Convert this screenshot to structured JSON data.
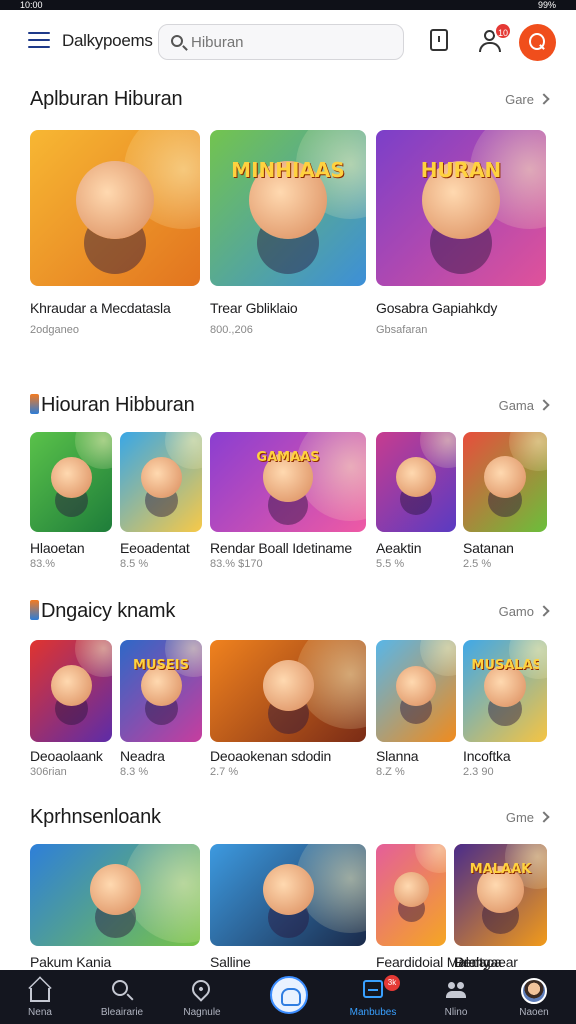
{
  "statusbar": {
    "left": "10:00",
    "right": "99%"
  },
  "header": {
    "brand": "Dalkypoems",
    "search": {
      "value": "",
      "placeholder": "Hiburan"
    },
    "notification_count": "10"
  },
  "sections": [
    {
      "title": "Aplburan Hiburan",
      "more": "Gare",
      "marker": false,
      "items": [
        {
          "title": "Khraudar a Mecdatasla",
          "meta": "2odganeo",
          "colors": [
            "#f7b733",
            "#e2741f"
          ],
          "banner": ""
        },
        {
          "title": "Trear Gbliklaio",
          "meta": "800.,206",
          "colors": [
            "#73c44e",
            "#3d8fd8"
          ],
          "banner": "MINHIAAS"
        },
        {
          "title": "Gosabra Gapiahkdy",
          "meta": "Gbsafaran",
          "colors": [
            "#7b3fc9",
            "#e0529a"
          ],
          "banner": "HURAN"
        }
      ]
    },
    {
      "title": "Hiouran Hibburan",
      "more": "Gama",
      "marker": true,
      "items": [
        {
          "title": "Hlaoetan",
          "meta": "83.%",
          "colors": [
            "#5ac24a",
            "#1e7d3a"
          ],
          "banner": ""
        },
        {
          "title": "Eeoadentat",
          "meta": "8.5 %",
          "colors": [
            "#39a7e6",
            "#f7c948"
          ],
          "banner": ""
        },
        {
          "title": "Rendar Boall Idetiname",
          "meta": "83.% $170",
          "colors": [
            "#8a3ed1",
            "#ef5aa4"
          ],
          "banner": "GAMAAS"
        },
        {
          "title": "Aeaktin",
          "meta": "5.5 %",
          "colors": [
            "#c73c8f",
            "#5a3bc2"
          ],
          "banner": ""
        },
        {
          "title": "Satanan",
          "meta": "2.5 %",
          "colors": [
            "#e84d3c",
            "#6bbf3b"
          ],
          "banner": ""
        }
      ]
    },
    {
      "title": "Dngaicy knamk",
      "more": "Gamo",
      "marker": true,
      "items": [
        {
          "title": "Deoaolaank",
          "meta": "306rian",
          "colors": [
            "#e0342f",
            "#5d2ca8"
          ],
          "banner": ""
        },
        {
          "title": "Neadra",
          "meta": "8.3 %",
          "colors": [
            "#2e68c7",
            "#c73d9e"
          ],
          "banner": "MUSEIS"
        },
        {
          "title": "Deoaokenan sdodin",
          "meta": "2.7 %",
          "colors": [
            "#f0821e",
            "#7a2b16"
          ],
          "banner": ""
        },
        {
          "title": "Slanna",
          "meta": "8.Z %",
          "colors": [
            "#58b6e8",
            "#f08b1d"
          ],
          "banner": ""
        },
        {
          "title": "Incoftka",
          "meta": "2.3 90",
          "colors": [
            "#3fa8e8",
            "#f5c443"
          ],
          "banner": "MUSALAS"
        }
      ]
    },
    {
      "title": "Kprhnsenloank",
      "more": "Gme",
      "marker": false,
      "items": [
        {
          "title": "Pakum Kania",
          "meta": "",
          "colors": [
            "#2e7fd9",
            "#78c447"
          ],
          "banner": ""
        },
        {
          "title": "Salline",
          "meta": "",
          "colors": [
            "#3d9ae0",
            "#1a2a4a"
          ],
          "banner": ""
        },
        {
          "title": "Feardidoial Malaity",
          "meta": "",
          "colors": [
            "#e45e9a",
            "#f5a623"
          ],
          "banner": ""
        },
        {
          "title": "Rrelaoa",
          "meta": "",
          "colors": [
            "#e8392f",
            "#f2b01e"
          ],
          "banner": ""
        },
        {
          "title": "Demgaear",
          "meta": "",
          "colors": [
            "#4a2c8a",
            "#f29b1a"
          ],
          "banner": "MALAAK"
        }
      ]
    }
  ],
  "bottom_nav": [
    {
      "label": "Nena",
      "icon": "home-icon"
    },
    {
      "label": "Bleairarie",
      "icon": "search-icon"
    },
    {
      "label": "Nagnule",
      "icon": "location-pin-icon"
    },
    {
      "label": "",
      "icon": "camera-icon"
    },
    {
      "label": "Manbubes",
      "icon": "inbox-icon",
      "active": true,
      "badge": "3k"
    },
    {
      "label": "Nlino",
      "icon": "people-icon"
    },
    {
      "label": "Naoen",
      "icon": "avatar"
    }
  ]
}
